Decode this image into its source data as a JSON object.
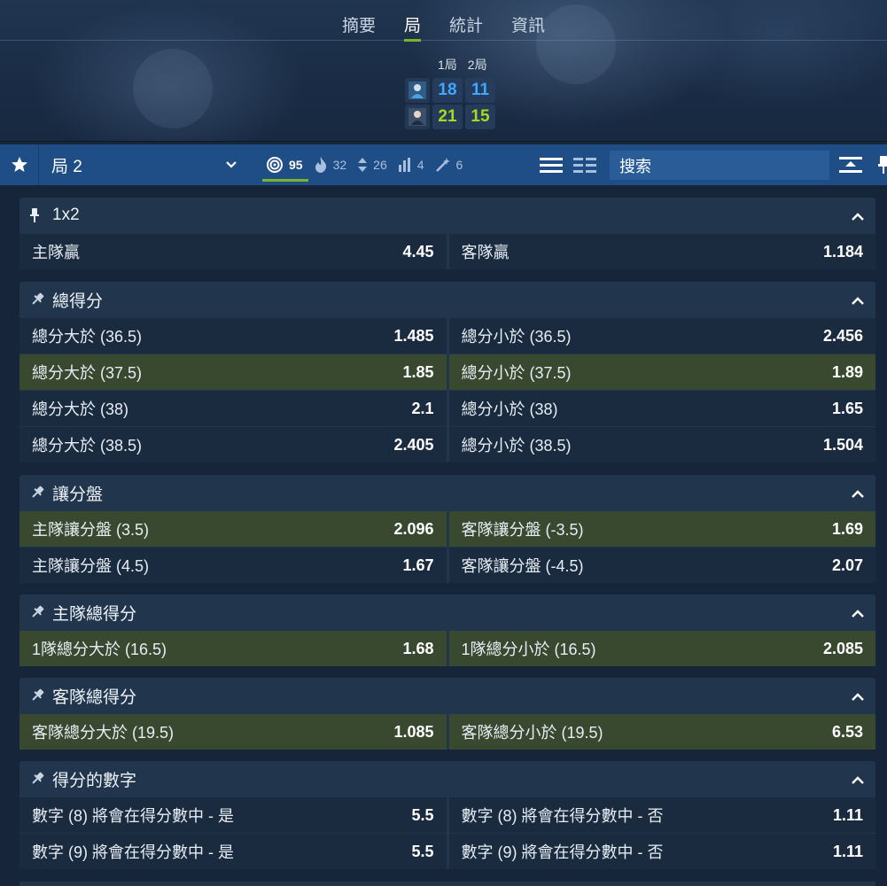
{
  "tabs": [
    "摘要",
    "局",
    "統計",
    "資訊"
  ],
  "active_tab": 1,
  "scoreboard": {
    "period_labels": [
      "1局",
      "2局"
    ],
    "home_scores": [
      "18",
      "11"
    ],
    "away_scores": [
      "21",
      "15"
    ]
  },
  "filterbar": {
    "period_select": "局 2",
    "counters": [
      {
        "icon": "target-icon",
        "count": "95",
        "active": true
      },
      {
        "icon": "flame-icon",
        "count": "32",
        "active": false
      },
      {
        "icon": "up-down-arrows-icon",
        "count": "26",
        "active": false
      },
      {
        "icon": "bar-chart-icon",
        "count": "4",
        "active": false
      },
      {
        "icon": "magic-wand-icon",
        "count": "6",
        "active": false
      }
    ],
    "search_placeholder": "搜索"
  },
  "markets": [
    {
      "title": "1x2",
      "pinned": true,
      "rows": [
        [
          {
            "label": "主隊贏",
            "price": "4.45"
          },
          {
            "label": "客隊贏",
            "price": "1.184"
          }
        ]
      ],
      "highlight": [
        false
      ]
    },
    {
      "title": "總得分",
      "pinned": false,
      "rows": [
        [
          {
            "label": "總分大於 (36.5)",
            "price": "1.485"
          },
          {
            "label": "總分小於 (36.5)",
            "price": "2.456"
          }
        ],
        [
          {
            "label": "總分大於 (37.5)",
            "price": "1.85"
          },
          {
            "label": "總分小於 (37.5)",
            "price": "1.89"
          }
        ],
        [
          {
            "label": "總分大於 (38)",
            "price": "2.1"
          },
          {
            "label": "總分小於 (38)",
            "price": "1.65"
          }
        ],
        [
          {
            "label": "總分大於 (38.5)",
            "price": "2.405"
          },
          {
            "label": "總分小於 (38.5)",
            "price": "1.504"
          }
        ]
      ],
      "highlight": [
        false,
        true,
        false,
        false
      ]
    },
    {
      "title": "讓分盤",
      "pinned": false,
      "rows": [
        [
          {
            "label": "主隊讓分盤 (3.5)",
            "price": "2.096"
          },
          {
            "label": "客隊讓分盤 (-3.5)",
            "price": "1.69"
          }
        ],
        [
          {
            "label": "主隊讓分盤 (4.5)",
            "price": "1.67"
          },
          {
            "label": "客隊讓分盤 (-4.5)",
            "price": "2.07"
          }
        ]
      ],
      "highlight": [
        true,
        false
      ]
    },
    {
      "title": "主隊總得分",
      "pinned": false,
      "rows": [
        [
          {
            "label": "1隊總分大於 (16.5)",
            "price": "1.68"
          },
          {
            "label": "1隊總分小於 (16.5)",
            "price": "2.085"
          }
        ]
      ],
      "highlight": [
        true
      ]
    },
    {
      "title": "客隊總得分",
      "pinned": false,
      "rows": [
        [
          {
            "label": "客隊總分大於 (19.5)",
            "price": "1.085"
          },
          {
            "label": "客隊總分小於 (19.5)",
            "price": "6.53"
          }
        ]
      ],
      "highlight": [
        true
      ]
    },
    {
      "title": "得分的數字",
      "pinned": false,
      "rows": [
        [
          {
            "label": "數字 (8) 將會在得分數中 - 是",
            "price": "5.5"
          },
          {
            "label": "數字 (8) 將會在得分數中 - 否",
            "price": "1.11"
          }
        ],
        [
          {
            "label": "數字 (9) 將會在得分數中 - 是",
            "price": "5.5"
          },
          {
            "label": "數字 (9) 將會在得分數中 - 否",
            "price": "1.11"
          }
        ]
      ],
      "highlight": [
        false,
        false
      ]
    }
  ]
}
